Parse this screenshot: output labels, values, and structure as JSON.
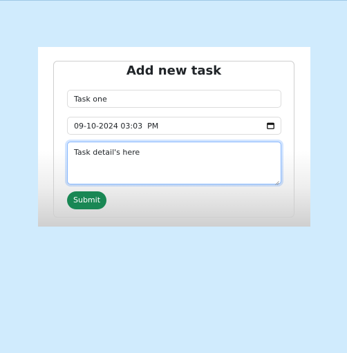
{
  "form": {
    "title": "Add new task",
    "task_name_value": "Task one",
    "date_value": "09-10-2024 03:03  PM",
    "details_value": "Task detail's here",
    "submit_label": "Submit"
  },
  "icons": {
    "date_picker": "calendar-icon",
    "textarea_resize": "resize-handle-icon"
  },
  "colors": {
    "page_background": "#d0ebfd",
    "submit_button": "#198754",
    "focus_border": "#86b7fe"
  }
}
